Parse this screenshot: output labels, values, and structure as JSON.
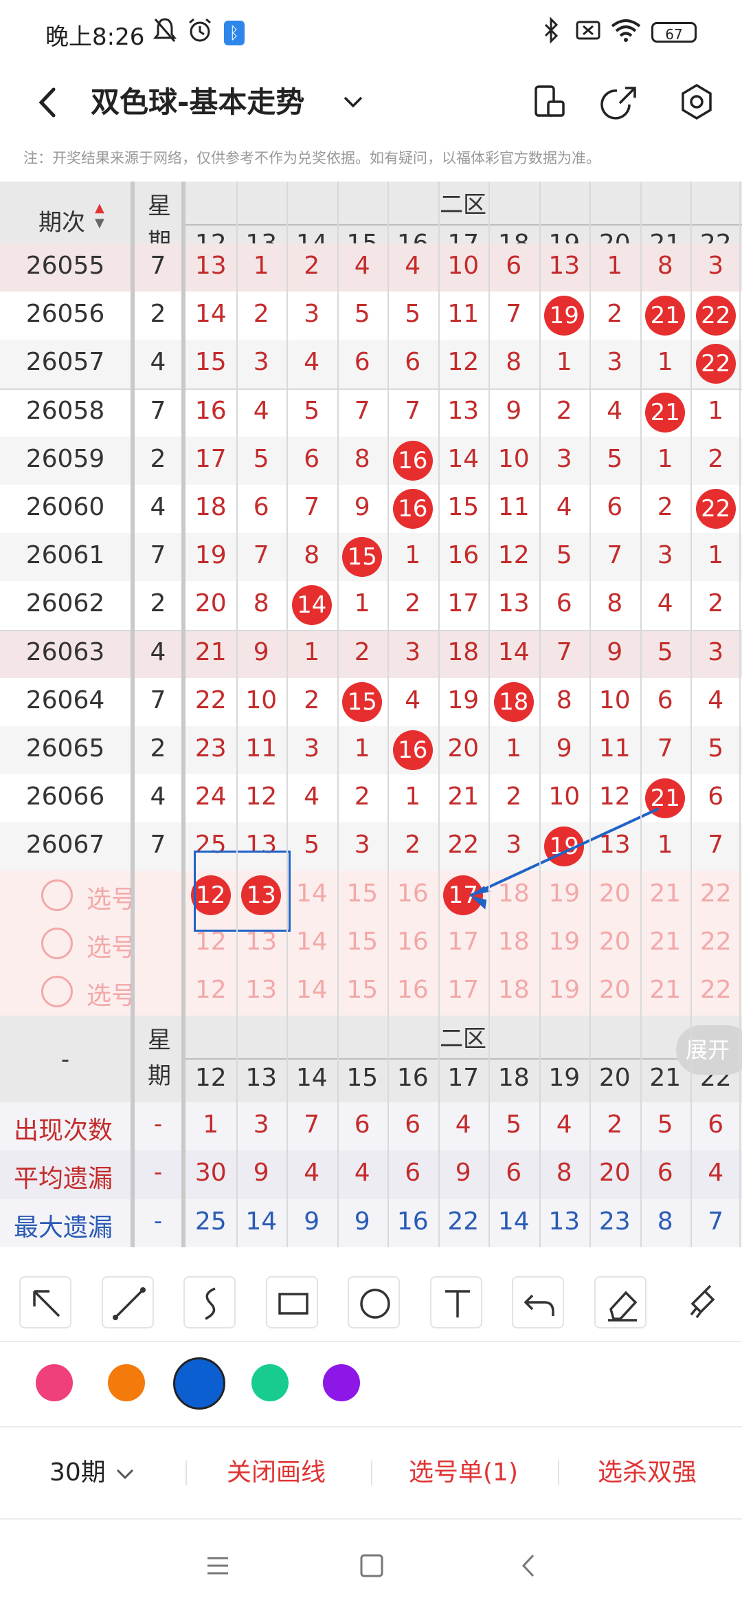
{
  "status": {
    "time": "晚上8:26",
    "battery": "67"
  },
  "header": {
    "title": "双色球-基本走势"
  },
  "notice": "注：开奖结果来源于网络，仅供参考不作为兑奖依据。如有疑问，以福体彩官方数据为准。",
  "table": {
    "col_period_label": "期次",
    "col_week_label": "星\n期",
    "zone_label": "二区",
    "columns": [
      "12",
      "13",
      "14",
      "15",
      "16",
      "17",
      "18",
      "19",
      "20",
      "21",
      "22"
    ],
    "rows": [
      {
        "period": "26055",
        "week": "7",
        "cells": [
          "13",
          "1",
          "2",
          "4",
          "4",
          "10",
          "6",
          "13",
          "1",
          "8",
          "3"
        ],
        "balls": []
      },
      {
        "period": "26056",
        "week": "2",
        "cells": [
          "14",
          "2",
          "3",
          "5",
          "5",
          "11",
          "7",
          "19",
          "2",
          "21",
          "22"
        ],
        "balls": [
          "19",
          "21",
          "22"
        ]
      },
      {
        "period": "26057",
        "week": "4",
        "cells": [
          "15",
          "3",
          "4",
          "6",
          "6",
          "12",
          "8",
          "1",
          "3",
          "1",
          "22"
        ],
        "balls": [
          "22"
        ]
      },
      {
        "period": "26058",
        "week": "7",
        "cells": [
          "16",
          "4",
          "5",
          "7",
          "7",
          "13",
          "9",
          "2",
          "4",
          "21",
          "1"
        ],
        "balls": [
          "21"
        ]
      },
      {
        "period": "26059",
        "week": "2",
        "cells": [
          "17",
          "5",
          "6",
          "8",
          "16",
          "14",
          "10",
          "3",
          "5",
          "1",
          "2"
        ],
        "balls": [
          "16"
        ]
      },
      {
        "period": "26060",
        "week": "4",
        "cells": [
          "18",
          "6",
          "7",
          "9",
          "16",
          "15",
          "11",
          "4",
          "6",
          "2",
          "22"
        ],
        "balls": [
          "16",
          "22"
        ]
      },
      {
        "period": "26061",
        "week": "7",
        "cells": [
          "19",
          "7",
          "8",
          "15",
          "1",
          "16",
          "12",
          "5",
          "7",
          "3",
          "1"
        ],
        "balls": [
          "15"
        ]
      },
      {
        "period": "26062",
        "week": "2",
        "cells": [
          "20",
          "8",
          "14",
          "1",
          "2",
          "17",
          "13",
          "6",
          "8",
          "4",
          "2"
        ],
        "balls": [
          "14"
        ]
      },
      {
        "period": "26063",
        "week": "4",
        "cells": [
          "21",
          "9",
          "1",
          "2",
          "3",
          "18",
          "14",
          "7",
          "9",
          "5",
          "3"
        ],
        "balls": []
      },
      {
        "period": "26064",
        "week": "7",
        "cells": [
          "22",
          "10",
          "2",
          "15",
          "4",
          "19",
          "18",
          "8",
          "10",
          "6",
          "4"
        ],
        "balls": [
          "15",
          "18"
        ]
      },
      {
        "period": "26065",
        "week": "2",
        "cells": [
          "23",
          "11",
          "3",
          "1",
          "16",
          "20",
          "1",
          "9",
          "11",
          "7",
          "5"
        ],
        "balls": [
          "16"
        ]
      },
      {
        "period": "26066",
        "week": "4",
        "cells": [
          "24",
          "12",
          "4",
          "2",
          "1",
          "21",
          "2",
          "10",
          "12",
          "21",
          "6"
        ],
        "balls": [
          "21"
        ]
      },
      {
        "period": "26067",
        "week": "7",
        "cells": [
          "25",
          "13",
          "5",
          "3",
          "2",
          "22",
          "3",
          "19",
          "13",
          "1",
          "7"
        ],
        "balls": [
          "19"
        ]
      }
    ],
    "pick_label": "选号",
    "pick_rows": [
      {
        "selected": [
          "12",
          "13",
          "17"
        ]
      },
      {
        "selected": []
      },
      {
        "selected": []
      }
    ],
    "footer_dash": "-",
    "expand_label": "展开",
    "stats": [
      {
        "label": "出现次数",
        "dash": "-",
        "values": [
          "1",
          "3",
          "7",
          "6",
          "6",
          "4",
          "5",
          "4",
          "2",
          "5",
          "6"
        ],
        "color": "#c42b2b"
      },
      {
        "label": "平均遗漏",
        "dash": "-",
        "values": [
          "30",
          "9",
          "4",
          "4",
          "6",
          "9",
          "6",
          "8",
          "20",
          "6",
          "4"
        ],
        "color": "#c42b2b"
      },
      {
        "label": "最大遗漏",
        "dash": "-",
        "values": [
          "25",
          "14",
          "9",
          "9",
          "16",
          "22",
          "14",
          "13",
          "23",
          "8",
          "7"
        ],
        "color": "#2a5bb5"
      }
    ]
  },
  "tools": [
    "arrow-tool-icon",
    "line-tool-icon",
    "curve-tool-icon",
    "rectangle-tool-icon",
    "circle-tool-icon",
    "text-tool-icon",
    "undo-icon",
    "eraser-icon",
    "clear-icon"
  ],
  "colors": [
    "#f0407c",
    "#f57a0c",
    "#0b5fd1",
    "#17cc8e",
    "#8c17e6"
  ],
  "selected_color": "#0b5fd1",
  "bottom": {
    "period_select": "30期",
    "close_line": "关闭画线",
    "pick_list": "选号单(1)",
    "kill": "选杀双强"
  }
}
